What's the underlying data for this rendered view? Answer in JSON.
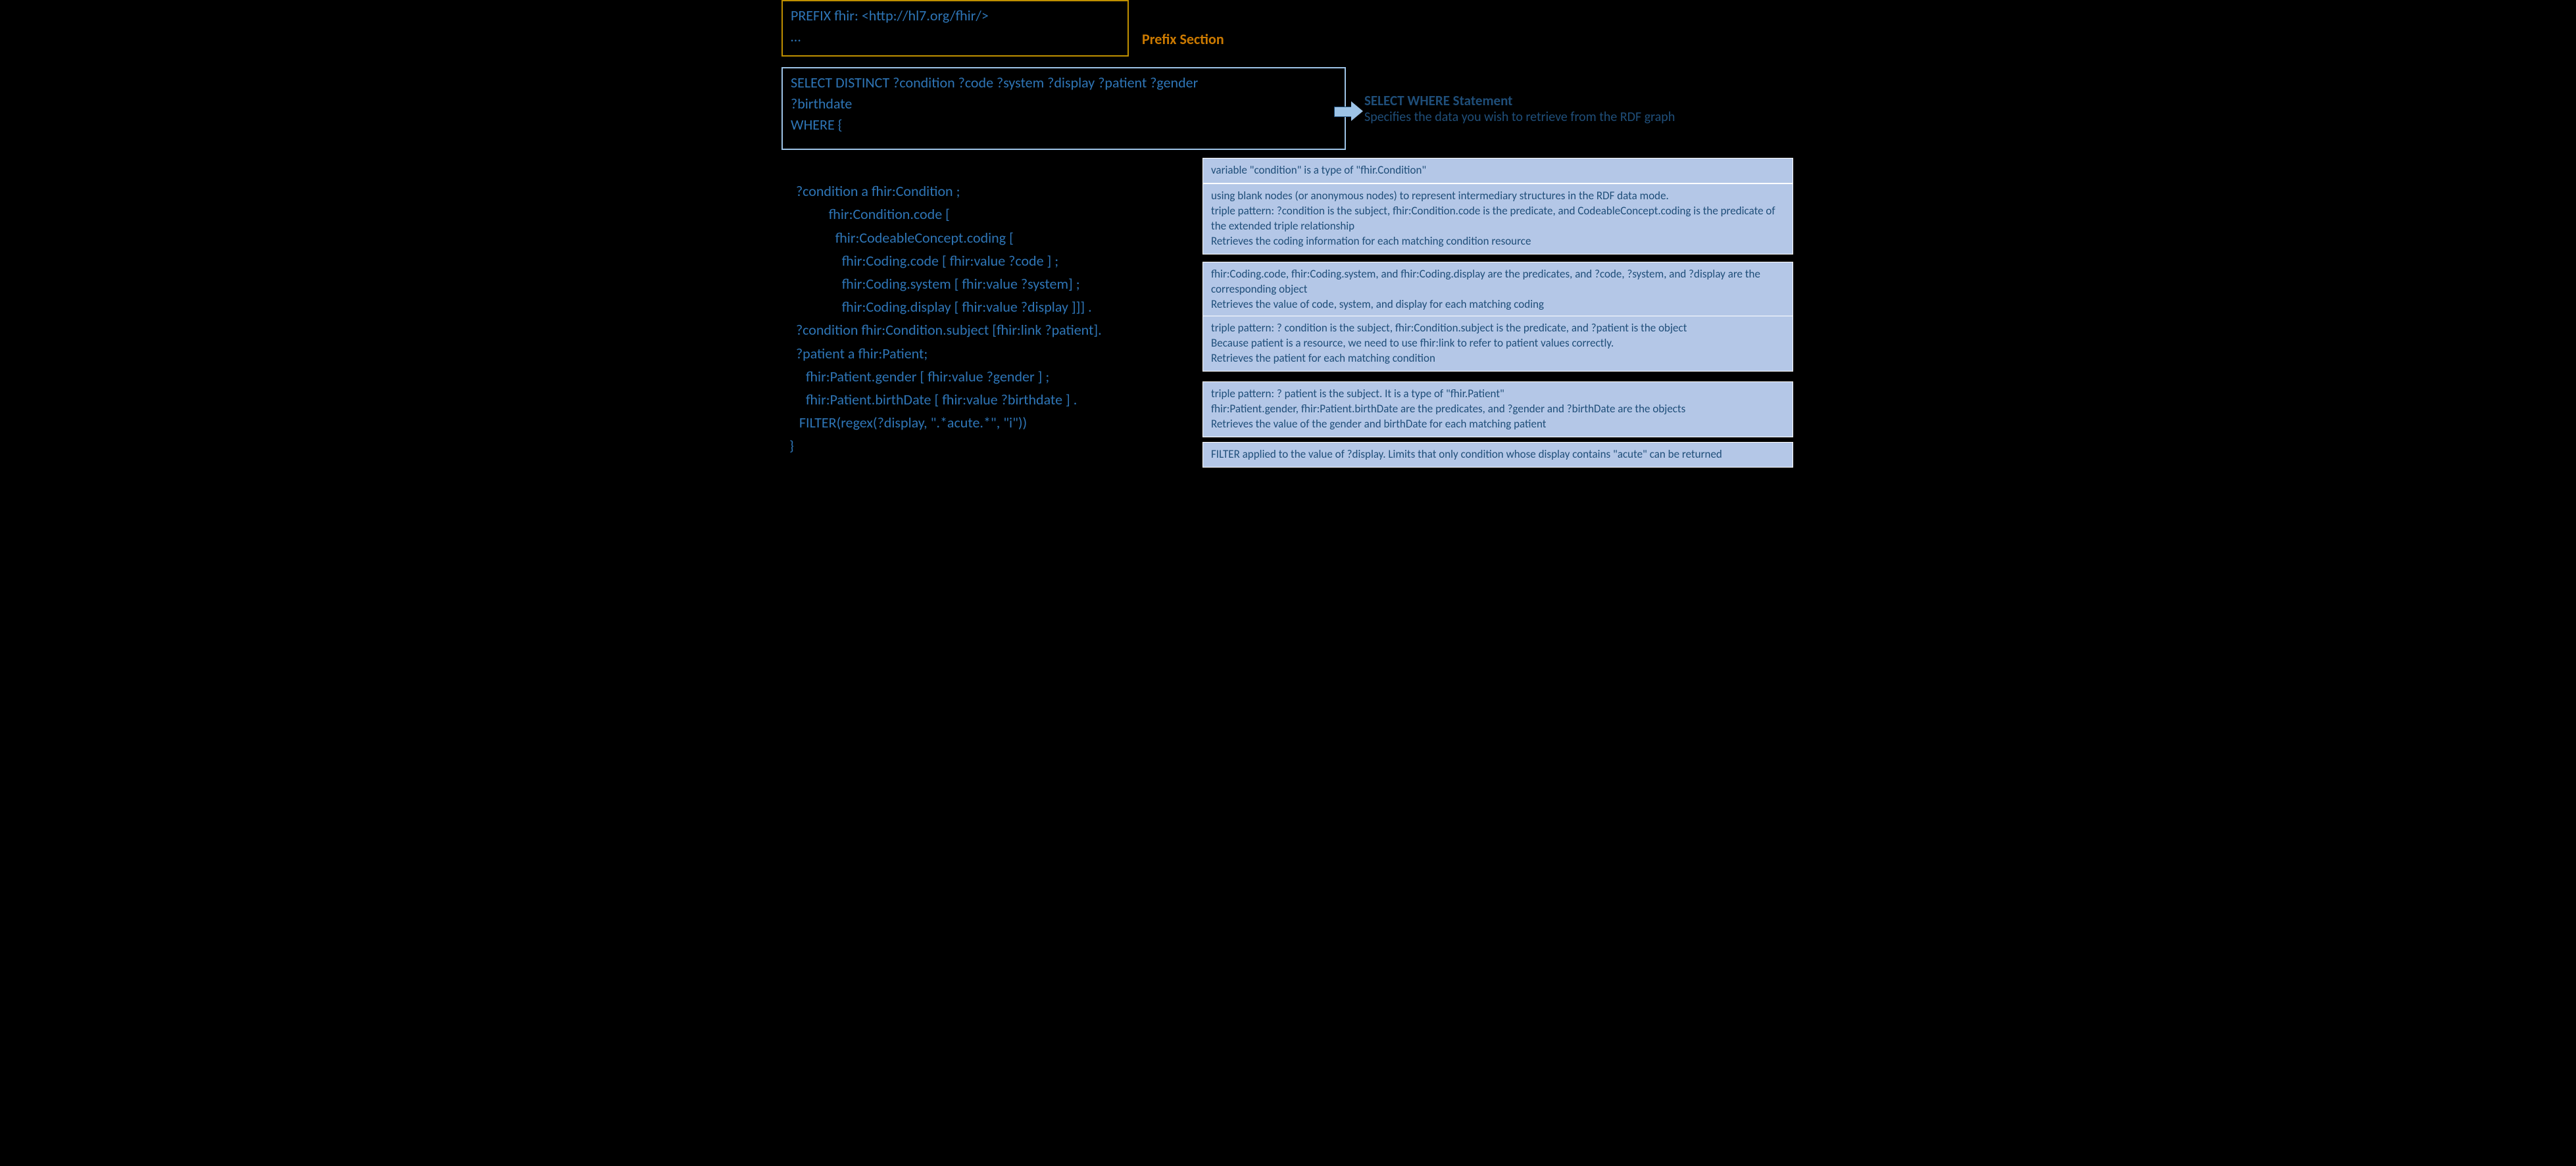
{
  "prefix": {
    "line1": "PREFIX fhir: <http://hl7.org/fhir/>",
    "line2": "…"
  },
  "labels": {
    "prefix": "Prefix Section",
    "select_title": "SELECT WHERE Statement",
    "select_sub": "Specifies the data you wish to retrieve from the RDF graph"
  },
  "select": {
    "line1": "SELECT DISTINCT ?condition ?code ?system ?display ?patient ?gender",
    "line2": "?birthdate",
    "line3": "WHERE {"
  },
  "body": {
    "l1": "  ?condition a fhir:Condition ;",
    "l2": "            fhir:Condition.code [",
    "l3": "              fhir:CodeableConcept.coding [",
    "l4": "                fhir:Coding.code [ fhir:value ?code ] ;",
    "l5": "                fhir:Coding.system [ fhir:value ?system] ;",
    "l6": "                fhir:Coding.display [ fhir:value ?display ]]] .",
    "l7": "  ?condition fhir:Condition.subject [fhir:link ?patient].",
    "l8": "  ?patient a fhir:Patient;",
    "l9": "     fhir:Patient.gender [ fhir:value ?gender ] ;",
    "l10": "     fhir:Patient.birthDate [ fhir:value ?birthdate ] .",
    "l11": "   FILTER(regex(?display, \".*acute.*\", \"i\"))",
    "l12": "}"
  },
  "annot": {
    "r1": "variable \"condition\" is a type of \"fhir.Condition\"",
    "r2": "using blank nodes (or anonymous nodes) to represent intermediary structures in the RDF data mode.\ntriple pattern: ?condition is the subject, fhir:Condition.code is the predicate, and CodeableConcept.coding is the predicate of the extended triple relationship\nRetrieves the coding information for each matching condition resource",
    "r3": "fhir:Coding.code, fhir:Coding.system, and fhir:Coding.display are the predicates, and ?code, ?system, and ?display are the corresponding object\nRetrieves the value of code, system, and display for each matching coding",
    "r4": "triple pattern: ? condition is the subject, fhir:Condition.subject is the predicate, and ?patient is the object\nBecause patient is a resource, we need to use fhir:link to refer to patient values correctly.\nRetrieves the patient for each matching condition",
    "r5": "triple pattern: ? patient is the subject. It is a type of \"fhir.Patient\"\nfhir:Patient.gender, fhir:Patient.birthDate are the predicates, and ?gender and ?birthDate are the objects\nRetrieves the value of the gender and birthDate for each matching patient",
    "r6": "FILTER applied to the value of ?display. Limits that only condition whose display contains \"acute\" can be returned"
  }
}
